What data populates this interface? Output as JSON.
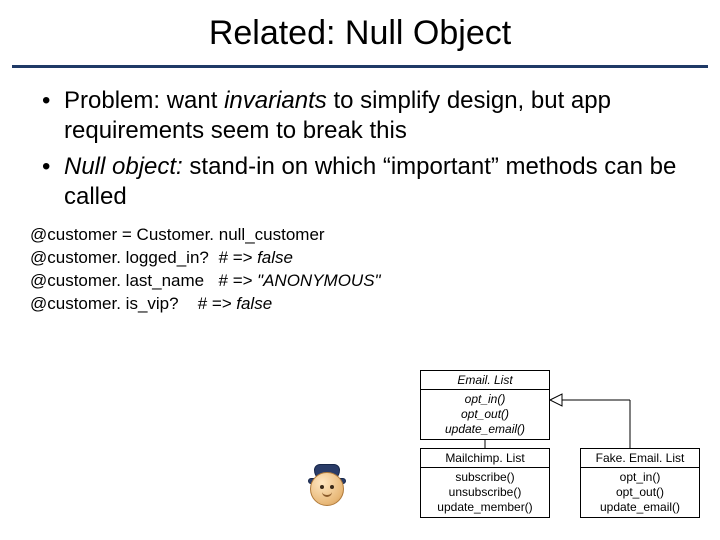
{
  "title": "Related: Null Object",
  "bullets": [
    {
      "pre": "Problem: want ",
      "em": "invariants",
      "post": " to simplify design, but app requirements seem to break this"
    },
    {
      "em2": "Null object:",
      "post2": " stand-in on which “important” methods can be called"
    }
  ],
  "code": [
    {
      "text": "@customer = Customer. null_customer",
      "comment": ""
    },
    {
      "text": "@customer. logged_in?  ",
      "comment": "# => false"
    },
    {
      "text": "@customer. last_name   ",
      "comment": "# => \"ANONYMOUS\""
    },
    {
      "text": "@customer. is_vip?    ",
      "comment": "# => false"
    }
  ],
  "uml": {
    "parent": {
      "name": "Email. List",
      "methods": [
        "opt_in()",
        "opt_out()",
        "update_email()"
      ]
    },
    "childL": {
      "name": "Mailchimp. List",
      "methods": [
        "subscribe()",
        "unsubscribe()",
        "update_member()"
      ]
    },
    "childR": {
      "name": "Fake. Email. List",
      "methods": [
        "opt_in()",
        "opt_out()",
        "update_email()"
      ]
    }
  }
}
